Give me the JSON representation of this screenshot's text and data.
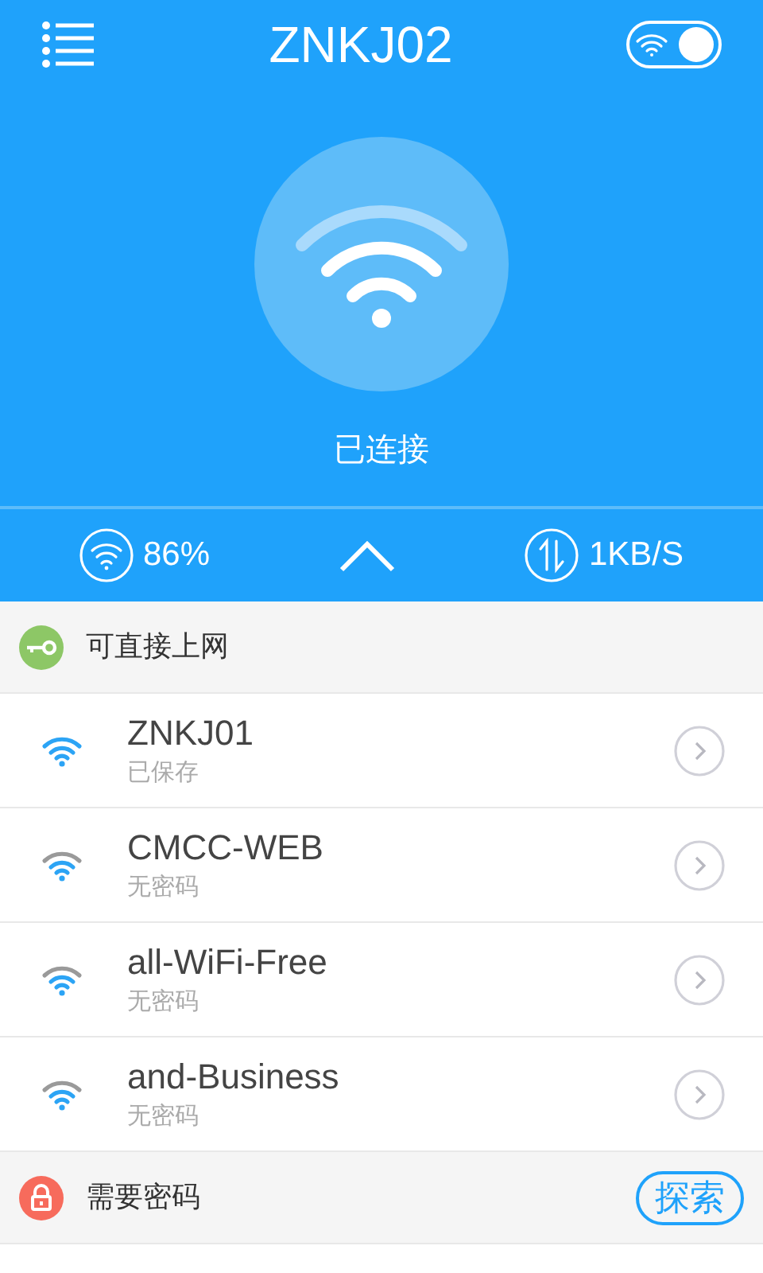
{
  "header": {
    "title": "ZNKJ02",
    "wifi_switch": {
      "on": true
    }
  },
  "status": {
    "text": "已连接"
  },
  "stats": {
    "signal": "86%",
    "speed": "1KB/S"
  },
  "sections": [
    {
      "title": "可直接上网",
      "kind": "open",
      "networks": [
        {
          "name": "ZNKJ01",
          "note": "已保存",
          "strong": true
        },
        {
          "name": "CMCC-WEB",
          "note": "无密码",
          "strong": false
        },
        {
          "name": "all-WiFi-Free",
          "note": "无密码",
          "strong": false
        },
        {
          "name": "and-Business",
          "note": "无密码",
          "strong": false
        }
      ]
    },
    {
      "title": "需要密码",
      "kind": "locked",
      "action": "探索"
    }
  ]
}
